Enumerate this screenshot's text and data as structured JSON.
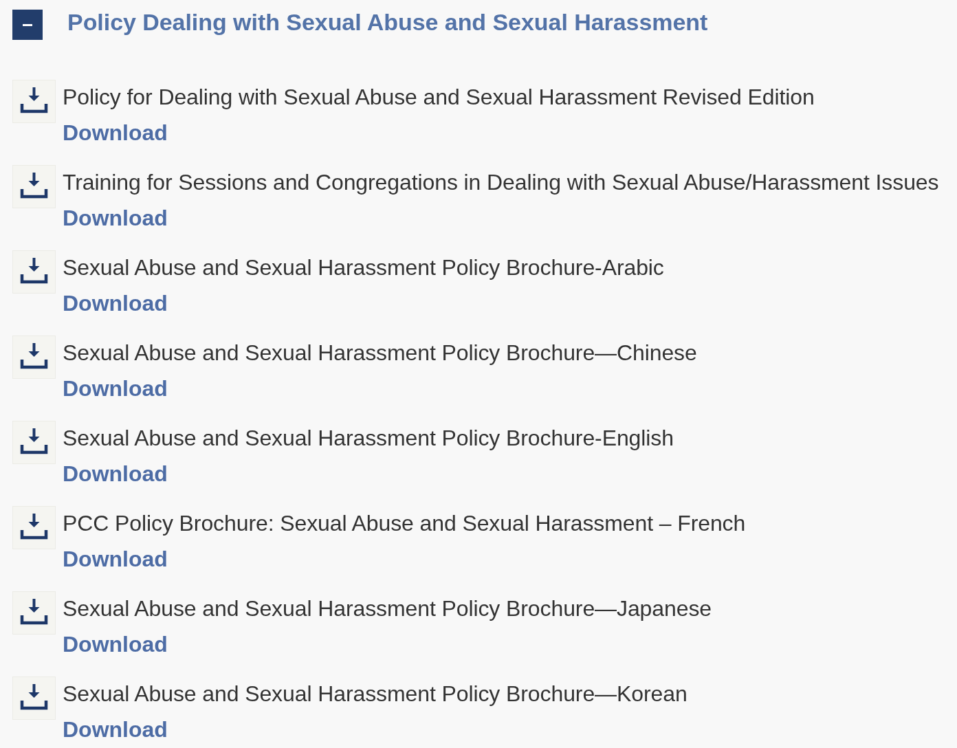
{
  "section": {
    "title": "Policy Dealing with Sexual Abuse and Sexual Harassment",
    "expanded": true
  },
  "documents": [
    {
      "title": "Policy for Dealing with Sexual Abuse and Sexual Harassment Revised Edition",
      "link": "Download"
    },
    {
      "title": "Training for Sessions and Congregations in Dealing with Sexual Abuse/Harassment Issues",
      "link": "Download"
    },
    {
      "title": "Sexual Abuse and Sexual Harassment Policy Brochure-Arabic",
      "link": "Download"
    },
    {
      "title": "Sexual Abuse and Sexual Harassment Policy Brochure—Chinese",
      "link": "Download"
    },
    {
      "title": "Sexual Abuse and Sexual Harassment Policy Brochure-English",
      "link": "Download"
    },
    {
      "title": "PCC Policy Brochure: Sexual Abuse and Sexual Harassment – French",
      "link": "Download"
    },
    {
      "title": "Sexual Abuse and Sexual Harassment Policy Brochure—Japanese",
      "link": "Download"
    },
    {
      "title": "Sexual Abuse and Sexual Harassment Policy Brochure—Korean",
      "link": "Download"
    }
  ]
}
